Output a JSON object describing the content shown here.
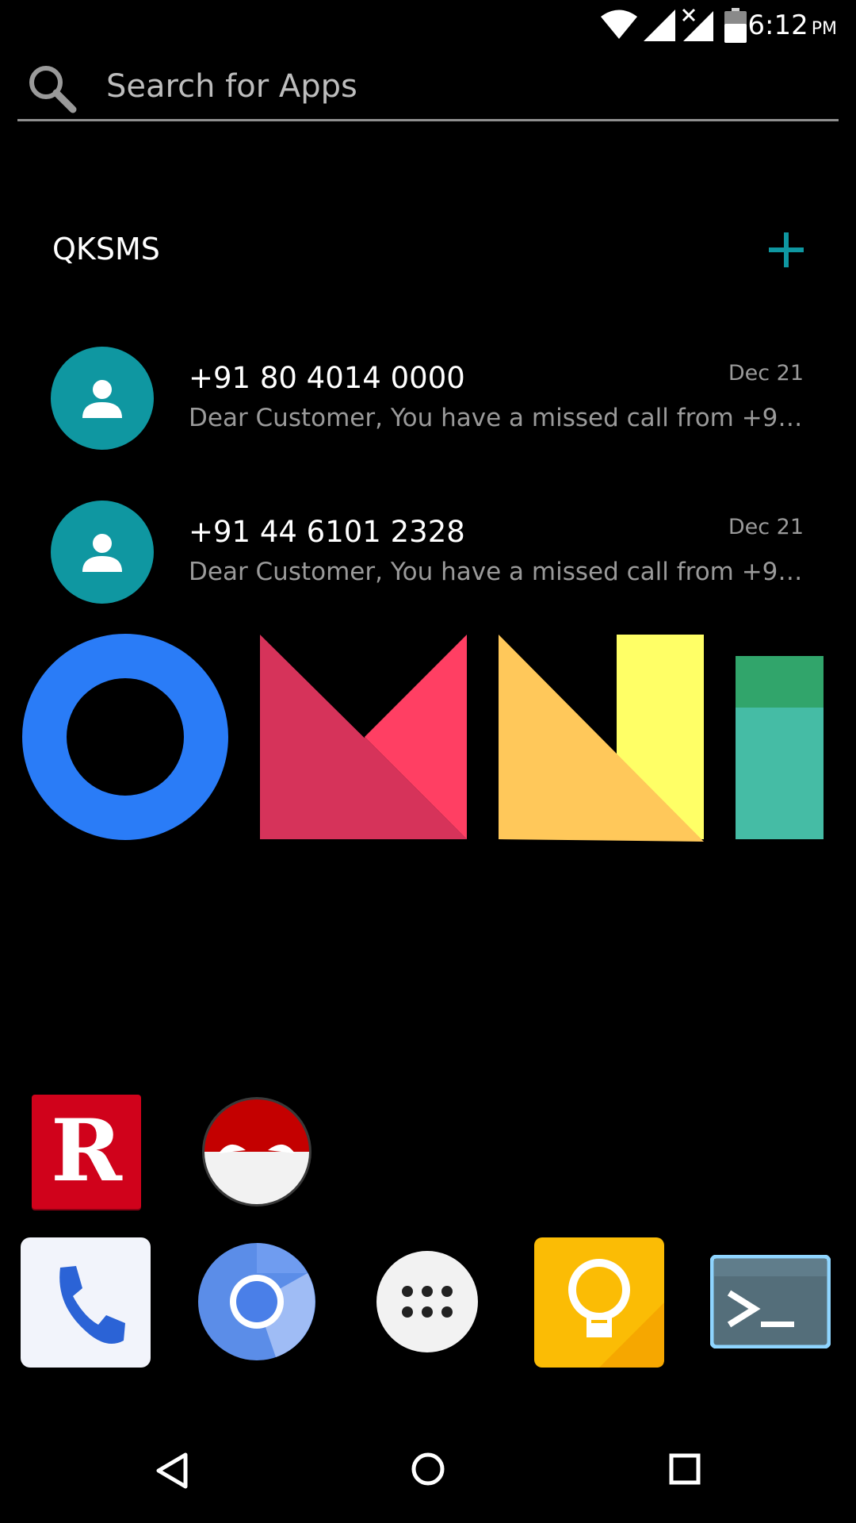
{
  "status_bar": {
    "time": "6:12",
    "ampm": "PM",
    "icons": [
      "wifi-icon",
      "cell-signal-icon",
      "cell-signal-no-data-icon",
      "battery-icon"
    ]
  },
  "search": {
    "placeholder": "Search for Apps"
  },
  "widget": {
    "title": "QKSMS",
    "add_icon": "plus-icon",
    "accent_color": "#0f97a1",
    "messages": [
      {
        "number": "+91 80 4014 0000",
        "preview": "Dear Customer, You have a missed call from +9180…",
        "date": "Dec 21"
      },
      {
        "number": "+91 44 6101 2328",
        "preview": "Dear Customer, You have a missed call from +9144…",
        "date": "Dec 21"
      }
    ]
  },
  "logo": {
    "text": "OMNI",
    "colors": [
      "#2a7cf7",
      "#d6335a",
      "#ff3f63",
      "#ffc85a",
      "#ffff66",
      "#31a56b",
      "#45bca5"
    ]
  },
  "home_apps": [
    {
      "icon": "r-app-icon",
      "letter": "R",
      "color": "#d0021b"
    },
    {
      "icon": "voltorb-icon",
      "color": "#c40000"
    }
  ],
  "dock": [
    {
      "icon": "phone-icon"
    },
    {
      "icon": "chromium-icon"
    },
    {
      "icon": "app-drawer-icon"
    },
    {
      "icon": "keep-bulb-icon"
    },
    {
      "icon": "terminal-icon"
    }
  ],
  "nav_bar": [
    "back-icon",
    "home-icon",
    "recents-icon"
  ]
}
